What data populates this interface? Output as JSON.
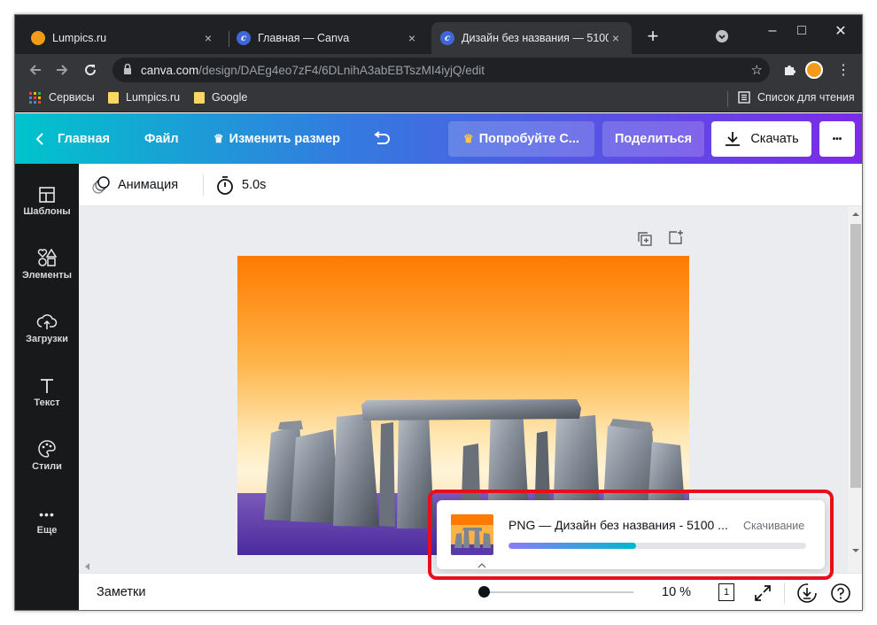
{
  "browser": {
    "tabs": [
      {
        "title": "Lumpics.ru",
        "favicon": "orange-circle-icon",
        "close": "×"
      },
      {
        "title": "Главная — Canva",
        "favicon": "canva-icon",
        "close": "×"
      },
      {
        "title": "Дизайн без названия — 5100",
        "favicon": "canva-icon",
        "close": "×"
      }
    ],
    "new_tab": "+",
    "window_controls": {
      "minimize": "–",
      "maximize": "□",
      "close": "✕"
    },
    "url": {
      "host": "canva.com",
      "path": "/design/DAEg4eo7zF4/6DLnihA3abEBTszMI4iyjQ/edit"
    },
    "bookmarks": [
      {
        "label": "Сервисы",
        "icon": "apps-grid-icon"
      },
      {
        "label": "Lumpics.ru",
        "icon": "folder-icon"
      },
      {
        "label": "Google",
        "icon": "folder-icon"
      }
    ],
    "reading_list": "Список для чтения"
  },
  "canva": {
    "header": {
      "home": "Главная",
      "file": "Файл",
      "resize": "Изменить размер",
      "try": "Попробуйте С...",
      "share": "Поделиться",
      "download": "Скачать",
      "more": "•••"
    },
    "sidebar": [
      {
        "label": "Шаблоны",
        "icon": "templates-icon"
      },
      {
        "label": "Элементы",
        "icon": "elements-icon"
      },
      {
        "label": "Загрузки",
        "icon": "upload-cloud-icon"
      },
      {
        "label": "Текст",
        "icon": "text-icon"
      },
      {
        "label": "Стили",
        "icon": "palette-icon"
      },
      {
        "label": "Еще",
        "icon": "more-dots-icon"
      }
    ],
    "toolbar": {
      "animation": "Анимация",
      "duration": "5.0s"
    },
    "bottom": {
      "notes": "Заметки",
      "zoom": "10 %",
      "page": "1",
      "zoom_fraction": 0.02
    },
    "download_popup": {
      "title": "PNG — Дизайн без названия - 5100 ...",
      "status": "Скачивание",
      "progress": 0.43
    },
    "colors": {
      "accent_gradient_start": "#00c4cc",
      "accent_gradient_end": "#7d2ae8",
      "progress_start": "#8b7cf6",
      "progress_end": "#00b8cc",
      "highlight": "#e60f1e"
    }
  }
}
